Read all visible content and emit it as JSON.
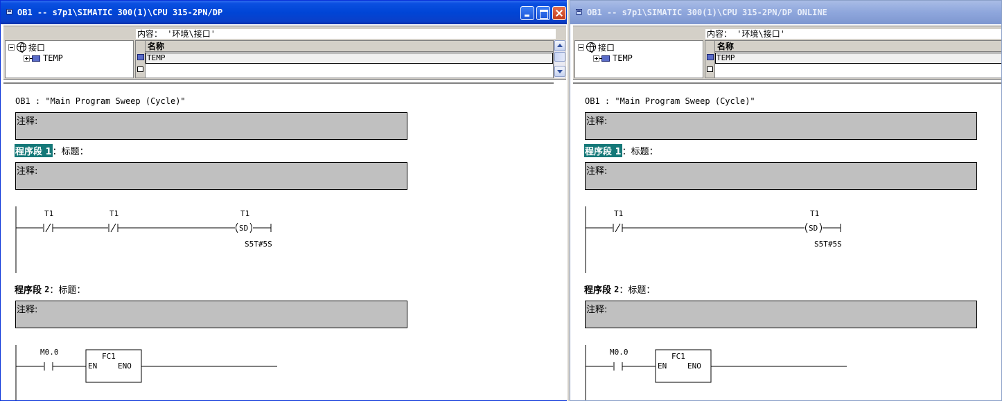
{
  "left": {
    "title": "OB1 -- s7p1\\SIMATIC 300(1)\\CPU 315-2PN/DP",
    "decl": {
      "content_label": "内容：",
      "content_path": "'环境\\接口'",
      "tree_root": "接口",
      "tree_child": "TEMP",
      "column_header": "名称",
      "row1": "TEMP"
    },
    "code": {
      "block_title": "OB1 :  \"Main Program Sweep (Cycle)\"",
      "comment_label": "注释:",
      "network1": {
        "label": "程序段",
        "number": "1",
        "title": "：标题："
      },
      "network1_comment": "注释:",
      "rung1": {
        "contact1": "T1",
        "contact2": "T1",
        "coil": "T1",
        "coil_type": "SD",
        "timer_value": "S5T#5S"
      },
      "network2": {
        "label": "程序段",
        "number": "2",
        "title": "：标题："
      },
      "network2_comment": "注释:",
      "rung2": {
        "contact": "M0.0",
        "block_name": "FC1",
        "en": "EN",
        "eno": "ENO"
      }
    }
  },
  "right": {
    "title": "OB1 -- s7p1\\SIMATIC 300(1)\\CPU 315-2PN/DP  ONLINE",
    "decl": {
      "content_label": "内容：",
      "content_path": "'环境\\接口'",
      "tree_root": "接口",
      "tree_child": "TEMP",
      "column_header": "名称",
      "row1": "TEMP"
    },
    "code": {
      "block_title": "OB1 :  \"Main Program Sweep (Cycle)\"",
      "comment_label": "注释:",
      "network1": {
        "label": "程序段",
        "number": "1",
        "title": "：标题："
      },
      "network1_comment": "注释:",
      "rung1": {
        "contact1": "T1",
        "coil": "T1",
        "coil_type": "SD",
        "timer_value": "S5T#5S"
      },
      "network2": {
        "label": "程序段",
        "number": "2",
        "title": "：标题："
      },
      "network2_comment": "注释:",
      "rung2": {
        "contact": "M0.0",
        "block_name": "FC1",
        "en": "EN",
        "eno": "ENO"
      }
    }
  },
  "icons": {
    "window": "window-icon",
    "minimize": "minimize-icon",
    "maximize": "maximize-icon",
    "close": "close-icon",
    "interface": "interface-globe-icon",
    "variable": "variable-icon",
    "new_row": "new-row-icon"
  },
  "colors": {
    "active_title": "#0045d6",
    "inactive_title": "#8ea6dc",
    "network_highlight": "#147878",
    "comment_bg": "#c0c0c0"
  }
}
